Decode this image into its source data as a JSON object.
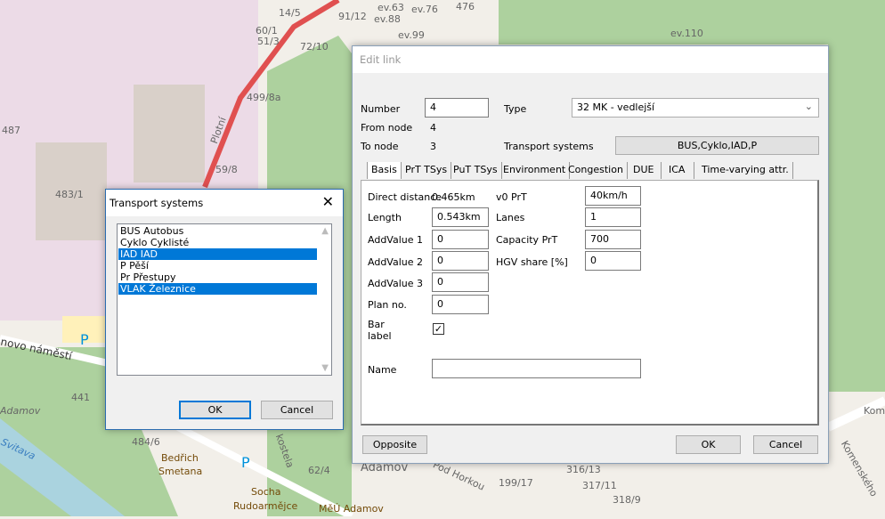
{
  "map": {
    "labels": [
      "14/5",
      "91/12",
      "ev.63",
      "ev.76",
      "476",
      "ev.88",
      "ev.99",
      "ev.110",
      "60/1",
      "51/3",
      "72/10",
      "499/8a",
      "487",
      "59/8",
      "483/1",
      "441",
      "484/6",
      "Bedřich",
      "Smetana",
      "62/4",
      "Adamov",
      "Socha",
      "Rudoarmějce",
      "MěÚ Adamov",
      "Pod Horkou",
      "199/17",
      "316/13",
      "317/11",
      "318/9",
      "Komenského",
      "Kom",
      "kostela",
      "Plotní",
      "novo náměstí",
      "Adamov",
      "Svitava",
      "P",
      "P"
    ]
  },
  "edit_link": {
    "title": "Edit link",
    "number_label": "Number",
    "number_value": "4",
    "type_label": "Type",
    "type_value": "32 MK - vedlejší",
    "from_node_label": "From node",
    "from_node_value": "4",
    "to_node_label": "To node",
    "to_node_value": "3",
    "tsys_label": "Transport systems",
    "tsys_value": "BUS,Cyklo,IAD,P",
    "tabs": [
      "Basis",
      "PrT TSys",
      "PuT TSys",
      "Environment",
      "Congestion",
      "DUE",
      "ICA",
      "Time-varying attr."
    ],
    "active_tab": "Basis",
    "basis": {
      "direct_distance_label": "Direct distance",
      "direct_distance_value": "0.465km",
      "length_label": "Length",
      "length_value": "0.543km",
      "addvalue1_label": "AddValue 1",
      "addvalue1_value": "0",
      "addvalue2_label": "AddValue 2",
      "addvalue2_value": "0",
      "addvalue3_label": "AddValue 3",
      "addvalue3_value": "0",
      "plan_no_label": "Plan no.",
      "plan_no_value": "0",
      "bar_label_label1": "Bar",
      "bar_label_label2": "label",
      "bar_label_checked": true,
      "name_label": "Name",
      "name_value": "",
      "v0_label": "v0 PrT",
      "v0_value": "40km/h",
      "lanes_label": "Lanes",
      "lanes_value": "1",
      "capacity_label": "Capacity PrT",
      "capacity_value": "700",
      "hgv_label": "HGV share [%]",
      "hgv_value": "0"
    },
    "opposite": "Opposite",
    "ok": "OK",
    "cancel": "Cancel"
  },
  "tsys_dialog": {
    "title": "Transport systems",
    "items": [
      {
        "label": "BUS Autobus",
        "selected": false
      },
      {
        "label": "Cyklo Cyklisté",
        "selected": false
      },
      {
        "label": "IAD IAD",
        "selected": true
      },
      {
        "label": "P Pěší",
        "selected": false
      },
      {
        "label": "Pr Přestupy",
        "selected": false
      },
      {
        "label": "VLAK Železnice",
        "selected": true
      }
    ],
    "ok": "OK",
    "cancel": "Cancel"
  },
  "colors": {
    "selection": "#0078d7",
    "map_green": "#add19e",
    "map_residential": "#e0dfdf",
    "map_commercial": "#f2dad9"
  }
}
